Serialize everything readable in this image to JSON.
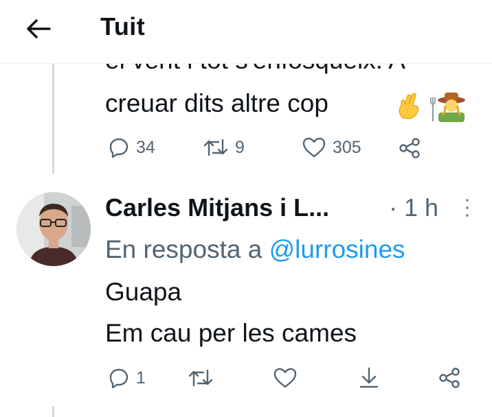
{
  "header": {
    "title": "Tuit",
    "back_icon": "arrow-left-icon"
  },
  "previous_tweet": {
    "text_line1": "el vent i tot s'enfosqueix. A",
    "text_line2": "creuar dits altre cop",
    "emojis": [
      "crossed-fingers-emoji",
      "farmer-woman-emoji"
    ],
    "actions": {
      "replies": "34",
      "retweets": "9",
      "likes": "305"
    }
  },
  "reply_tweet": {
    "author_name": "Carles Mitjans i L...",
    "time": "· 1 h",
    "reply_prefix": "En resposta a",
    "reply_mention": "@lurrosines",
    "body_line1": "Guapa",
    "body_line2": "Em cau per les cames",
    "actions": {
      "replies": "1"
    }
  },
  "colors": {
    "text": "#0f1419",
    "muted": "#536471",
    "link": "#1d9bf0",
    "thread_line": "#cfd9de"
  }
}
